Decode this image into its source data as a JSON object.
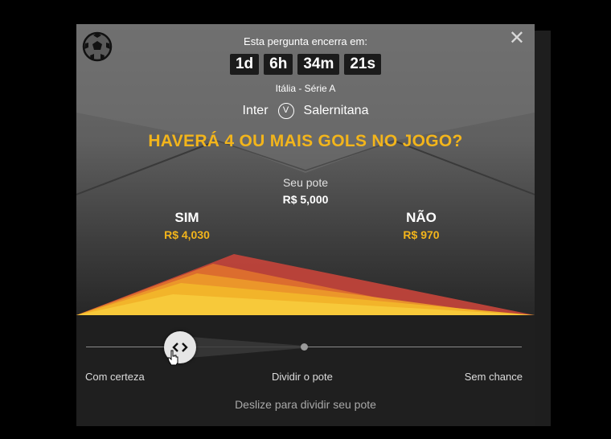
{
  "header": {
    "ends_label": "Esta pergunta encerra em:",
    "countdown": [
      {
        "value": "1d"
      },
      {
        "value": "6h"
      },
      {
        "value": "34m"
      },
      {
        "value": "21s"
      }
    ],
    "close_glyph": "✕"
  },
  "match": {
    "league": "Itália - Série A",
    "home": "Inter",
    "vs": "V",
    "away": "Salernitana"
  },
  "question": "HAVERÁ 4 OU MAIS GOLS NO JOGO?",
  "pot": {
    "label": "Seu pote",
    "value": "R$ 5,000"
  },
  "sides": {
    "yes": {
      "label": "SIM",
      "amount": "R$ 4,030"
    },
    "no": {
      "label": "NÃO",
      "amount": "R$ 970"
    }
  },
  "slider": {
    "position_fraction": 0.2,
    "labels": {
      "left": "Com certeza",
      "middle": "Dividir o pote",
      "right": "Sem chance"
    },
    "hint": "Deslize para dividir seu pote"
  },
  "colors": {
    "accent": "#f3b51b",
    "panel_dark": "#1f1f1f"
  },
  "icons": {
    "ball": "soccer-ball-icon",
    "close": "close-icon",
    "slider": "chevron-left-right-icon",
    "cursor": "hand-pointer-icon"
  }
}
